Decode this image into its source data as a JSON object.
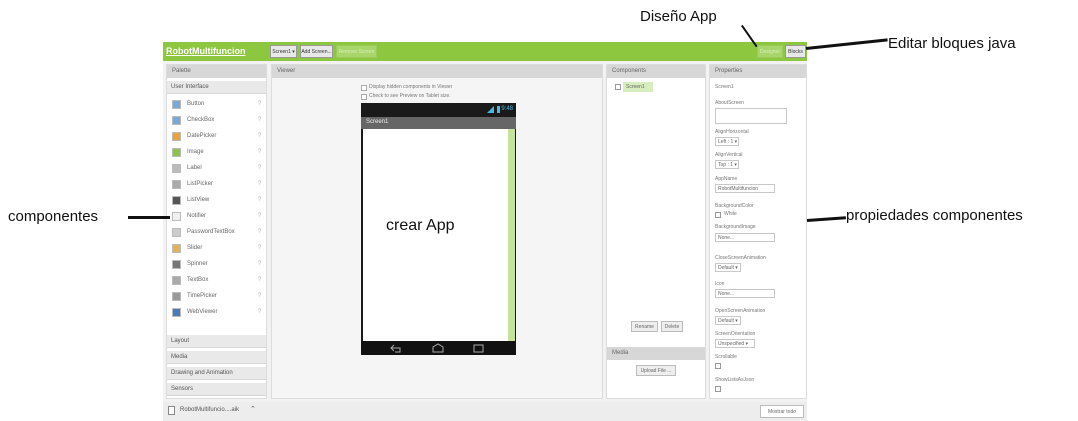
{
  "annotations": {
    "diseno": "Diseño App",
    "editar": "Editar bloques java",
    "componentes": "componentes",
    "crear": "crear App",
    "propiedades": "propiedades componentes"
  },
  "topbar": {
    "app_name": "RobotMultifuncion",
    "screen_button": "Screen1 ▾",
    "add_screen_button": "Add Screen...",
    "remove_screen_button": "Remove Screen",
    "designer_button": "Designer",
    "blocks_button": "Blocks"
  },
  "palette": {
    "header": "Palette",
    "section_user_interface": "User Interface",
    "items": [
      {
        "label": "Button",
        "icon": "button-icon"
      },
      {
        "label": "CheckBox",
        "icon": "checkbox-icon"
      },
      {
        "label": "DatePicker",
        "icon": "datepicker-icon"
      },
      {
        "label": "Image",
        "icon": "image-icon"
      },
      {
        "label": "Label",
        "icon": "label-icon"
      },
      {
        "label": "ListPicker",
        "icon": "listpicker-icon"
      },
      {
        "label": "ListView",
        "icon": "listview-icon"
      },
      {
        "label": "Notifier",
        "icon": "notifier-icon"
      },
      {
        "label": "PasswordTextBox",
        "icon": "password-icon"
      },
      {
        "label": "Slider",
        "icon": "slider-icon"
      },
      {
        "label": "Spinner",
        "icon": "spinner-icon"
      },
      {
        "label": "TextBox",
        "icon": "textbox-icon"
      },
      {
        "label": "TimePicker",
        "icon": "timepicker-icon"
      },
      {
        "label": "WebViewer",
        "icon": "webviewer-icon"
      }
    ],
    "question_mark": "?",
    "sections": [
      "Layout",
      "Media",
      "Drawing and Animation",
      "Sensors"
    ]
  },
  "viewer": {
    "header": "Viewer",
    "checkbox_hidden": "Display hidden components in Viewer",
    "checkbox_tablet": "Check to see Preview on Tablet size.",
    "phone_time": "9:48",
    "phone_title": "Screen1"
  },
  "components": {
    "header": "Components",
    "screen1": "Screen1",
    "rename_button": "Rename",
    "delete_button": "Delete",
    "media_header": "Media",
    "upload_button": "Upload File ..."
  },
  "properties": {
    "header": "Properties",
    "selected": "Screen1",
    "about_screen_label": "AboutScreen",
    "align_horizontal_label": "AlignHorizontal",
    "align_horizontal_value": "Left : 1 ▾",
    "align_vertical_label": "AlignVertical",
    "align_vertical_value": "Top : 1 ▾",
    "app_name_label": "AppName",
    "app_name_value": "RobotMultifuncion",
    "background_color_label": "BackgroundColor",
    "background_color_value": "White",
    "background_image_label": "BackgroundImage",
    "background_image_value": "None...",
    "close_anim_label": "CloseScreenAnimation",
    "close_anim_value": "Default ▾",
    "icon_label": "Icon",
    "icon_value": "None...",
    "open_anim_label": "OpenScreenAnimation",
    "open_anim_value": "Default ▾",
    "orientation_label": "ScreenOrientation",
    "orientation_value": "Unspecified ▾",
    "scrollable_label": "Scrollable",
    "show_listview_label": "ShowListsAsJson"
  },
  "bottombar": {
    "download_file": "RobotMultifuncio....aik",
    "show_all_button": "Mostrar todo"
  },
  "colors": {
    "accent": "#8dc63f",
    "panel_header": "#d7d7d7"
  }
}
